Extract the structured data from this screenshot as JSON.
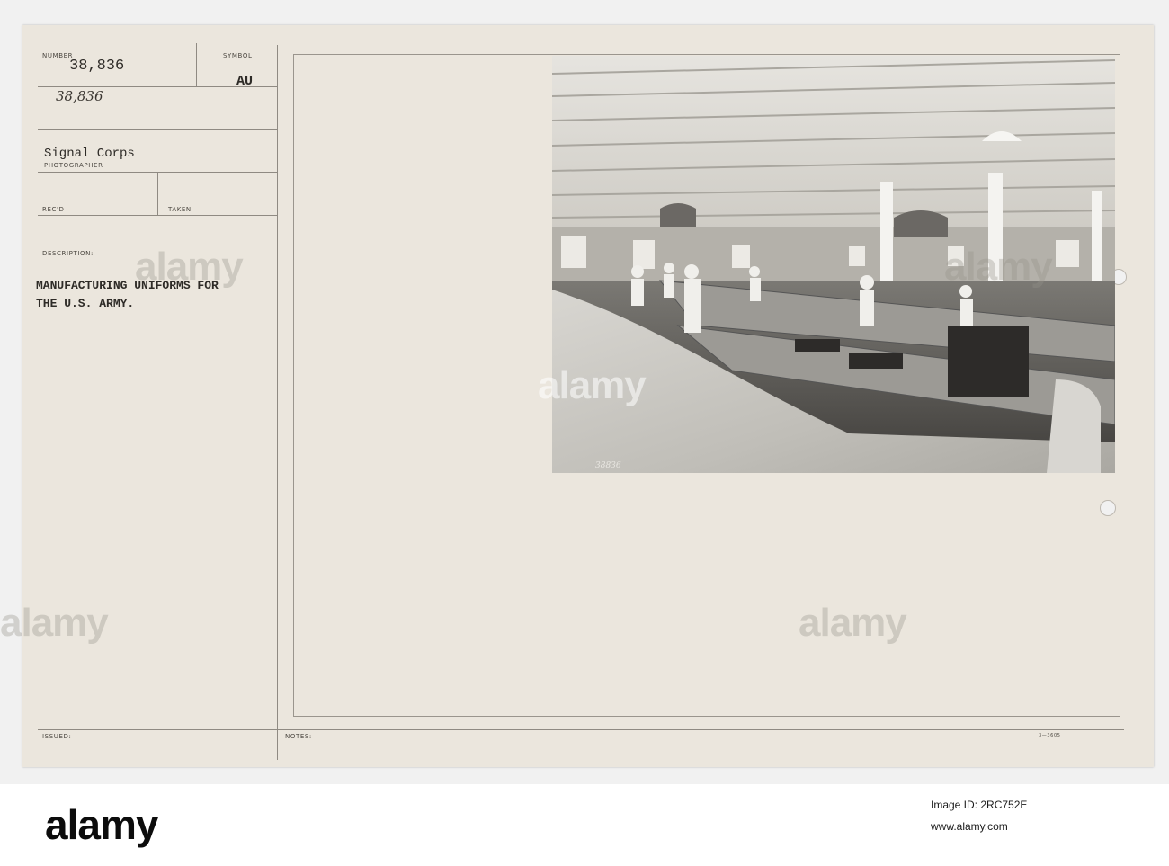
{
  "card": {
    "number_label": "NUMBER",
    "number_typed": "38,836",
    "number_handwritten": "38,836",
    "symbol_label": "SYMBOL",
    "symbol_value": "AU",
    "photographer_value": "Signal Corps",
    "photographer_label": "PHOTOGRAPHER",
    "recd_label": "REC'D",
    "taken_label": "TAKEN",
    "description_label": "DESCRIPTION:",
    "description_line1": "MANUFACTURING UNIFORMS FOR",
    "description_line2": "THE U.S. ARMY.",
    "issued_label": "ISSUED:",
    "notes_label": "NOTES:",
    "form_code": "3—3605",
    "photo_inscription": "38836"
  },
  "watermark": {
    "text": "alamy"
  },
  "footer": {
    "logo": "alamy",
    "image_id": "Image ID: 2RC752E",
    "site": "www.alamy.com"
  }
}
